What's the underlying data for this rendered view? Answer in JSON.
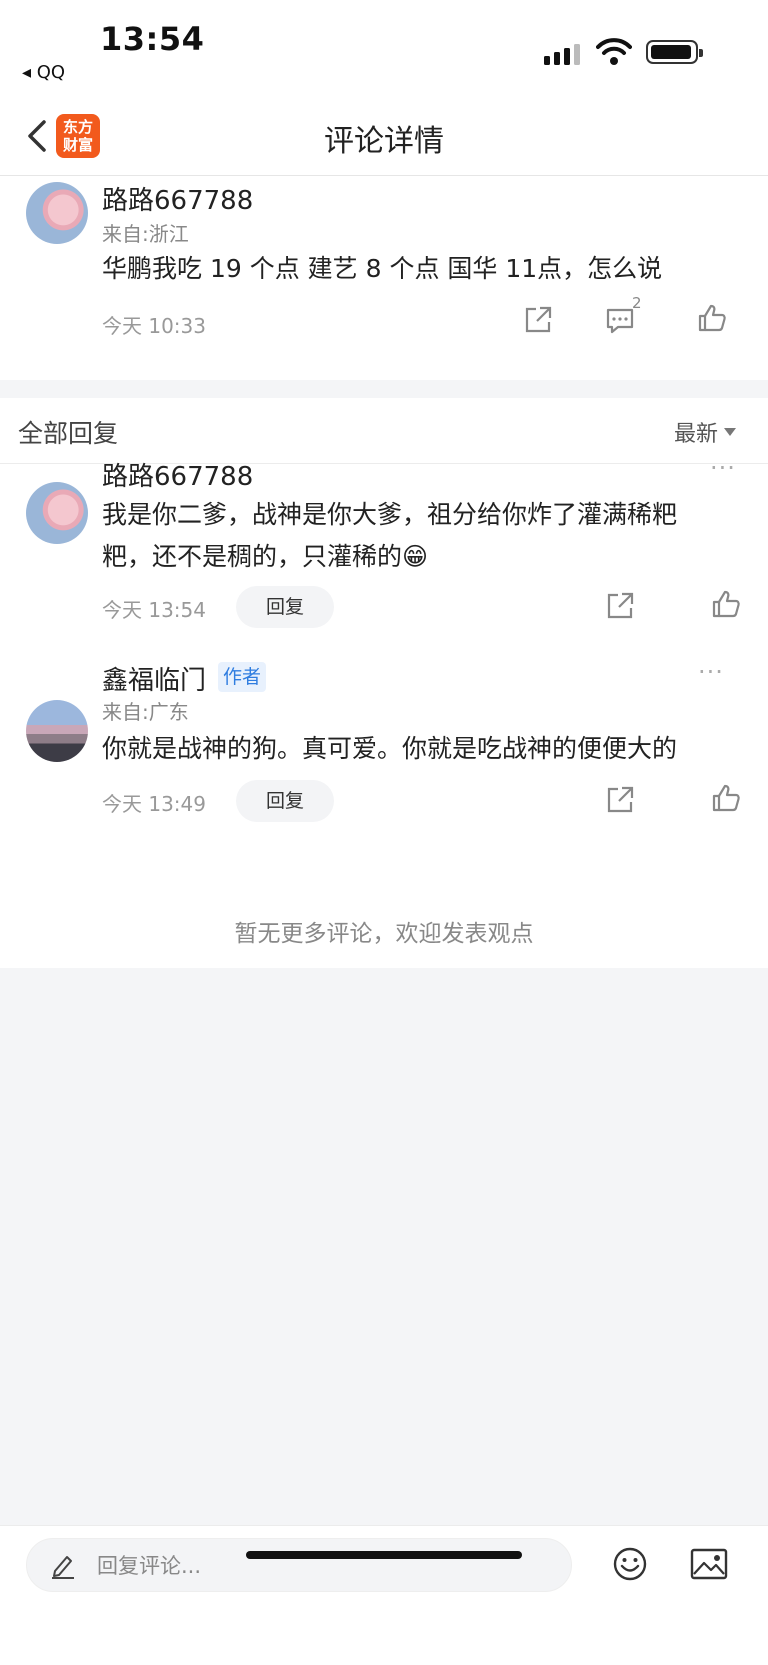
{
  "status_bar": {
    "time": "13:54",
    "back_app": "◂ QQ"
  },
  "nav": {
    "title": "评论详情",
    "logo_line1": "东方",
    "logo_line2": "财富",
    "brand_color": "#f25a1d"
  },
  "main_comment": {
    "user": "路路667788",
    "location": "来自:浙江",
    "text": "华鹏我吃 19 个点  建艺 8 个点  国华 11点，怎么说",
    "time": "今天 10:33",
    "comment_count": "2"
  },
  "replies_section": {
    "title": "全部回复",
    "sort_label": "最新"
  },
  "replies": [
    {
      "user": "路路667788",
      "text_line1": "我是你二爹，战神是你大爹，祖分给你炸了灌满稀粑",
      "text_line2": "粑，还不是稠的，只灌稀的😁",
      "time": "今天 13:54",
      "reply_label": "回复",
      "more": "···"
    },
    {
      "user": "鑫福临门",
      "author_tag": "作者",
      "location": "来自:广东",
      "text": "你就是战神的狗。真可爱。你就是吃战神的便便大的",
      "time": "今天 13:49",
      "reply_label": "回复",
      "more": "···"
    }
  ],
  "no_more_text": "暂无更多评论，欢迎发表观点",
  "bottom_bar": {
    "placeholder": "回复评论..."
  },
  "colors": {
    "author_tag_bg": "#e8f1fd",
    "author_tag_text": "#2f7de0"
  }
}
